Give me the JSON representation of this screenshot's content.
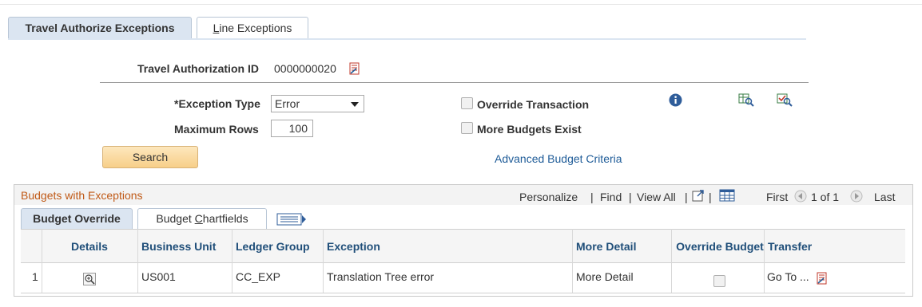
{
  "tabs": {
    "active": "Travel Authorize Exceptions",
    "inactive": "Line Exceptions"
  },
  "auth": {
    "label": "Travel Authorization ID",
    "value": "0000000020"
  },
  "criteria": {
    "exception_type_label": "*Exception Type",
    "exception_type_value": "Error",
    "max_rows_label": "Maximum Rows",
    "max_rows_value": "100",
    "override_label": "Override Transaction",
    "more_budgets_label": "More Budgets Exist",
    "search_label": "Search",
    "advanced_link": "Advanced Budget Criteria"
  },
  "grid": {
    "title": "Budgets with Exceptions",
    "personalize": "Personalize",
    "find": "Find",
    "view_all": "View All",
    "first": "First",
    "page_info": "1 of 1",
    "last": "Last",
    "tab_active": "Budget Override",
    "tab_inactive": "Budget Chartfields",
    "columns": [
      "Details",
      "Business Unit",
      "Ledger Group",
      "Exception",
      "More Detail",
      "Override Budget",
      "Transfer"
    ],
    "rows": [
      {
        "num": "1",
        "business_unit": "US001",
        "ledger_group": "CC_EXP",
        "exception": "Translation Tree error",
        "more_detail": "More Detail",
        "transfer": "Go To ..."
      }
    ]
  },
  "colors": {
    "link": "#1f5c98",
    "header_text": "#1f4e79",
    "panel_title": "#c05a17",
    "tab_active_bg": "#dbe5f1"
  },
  "icons": [
    "related-content-icon",
    "info-icon",
    "budget-inquiry-icon",
    "budget-check-icon",
    "zoom-detail-icon",
    "grid-settings-icon"
  ]
}
